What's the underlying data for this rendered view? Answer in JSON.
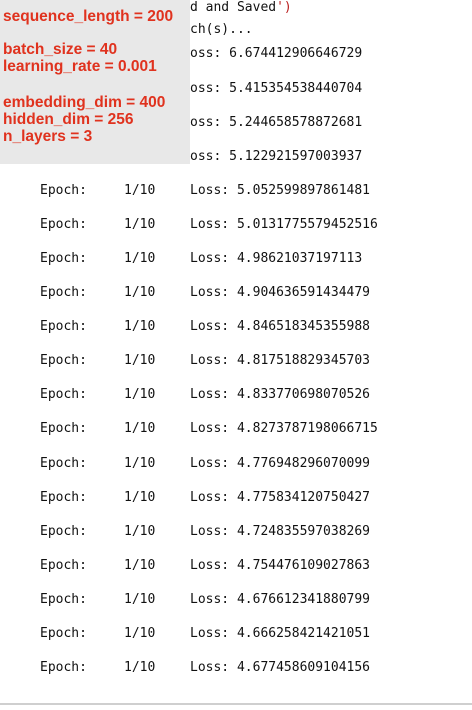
{
  "top_code": {
    "line1_prefix": "d and Saved",
    "line1_suffix": "')",
    "line2": "ch(s)..."
  },
  "partial_loss": [
    "oss: 6.674412906646729",
    "oss: 5.415354538440704",
    "oss: 5.244658578872681",
    "oss: 5.122921597003937"
  ],
  "log_rows": [
    {
      "epoch_label": "Epoch:",
      "fraction": "1/10",
      "loss": "Loss: 5.052599897861481"
    },
    {
      "epoch_label": "Epoch:",
      "fraction": "1/10",
      "loss": "Loss: 5.0131775579452516"
    },
    {
      "epoch_label": "Epoch:",
      "fraction": "1/10",
      "loss": "Loss: 4.98621037197113"
    },
    {
      "epoch_label": "Epoch:",
      "fraction": "1/10",
      "loss": "Loss: 4.904636591434479"
    },
    {
      "epoch_label": "Epoch:",
      "fraction": "1/10",
      "loss": "Loss: 4.846518345355988"
    },
    {
      "epoch_label": "Epoch:",
      "fraction": "1/10",
      "loss": "Loss: 4.817518829345703"
    },
    {
      "epoch_label": "Epoch:",
      "fraction": "1/10",
      "loss": "Loss: 4.833770698070526"
    },
    {
      "epoch_label": "Epoch:",
      "fraction": "1/10",
      "loss": "Loss: 4.8273787198066715"
    },
    {
      "epoch_label": "Epoch:",
      "fraction": "1/10",
      "loss": "Loss: 4.776948296070099"
    },
    {
      "epoch_label": "Epoch:",
      "fraction": "1/10",
      "loss": "Loss: 4.775834120750427"
    },
    {
      "epoch_label": "Epoch:",
      "fraction": "1/10",
      "loss": "Loss: 4.724835597038269"
    },
    {
      "epoch_label": "Epoch:",
      "fraction": "1/10",
      "loss": "Loss: 4.754476109027863"
    },
    {
      "epoch_label": "Epoch:",
      "fraction": "1/10",
      "loss": "Loss: 4.676612341880799"
    },
    {
      "epoch_label": "Epoch:",
      "fraction": "1/10",
      "loss": "Loss: 4.666258421421051"
    },
    {
      "epoch_label": "Epoch:",
      "fraction": "1/10",
      "loss": "Loss: 4.677458609104156"
    }
  ],
  "hyperparams": {
    "sequence_length": "sequence_length = 200",
    "batch_size": "batch_size = 40",
    "learning_rate": "learning_rate = 0.001",
    "embedding_dim": "embedding_dim = 400",
    "hidden_dim": "hidden_dim = 256",
    "n_layers": "n_layers = 3"
  },
  "colors": {
    "annotation_red": "#e0321e",
    "overlay_bg": "#e8e8e8",
    "string_red": "#ba2121"
  }
}
